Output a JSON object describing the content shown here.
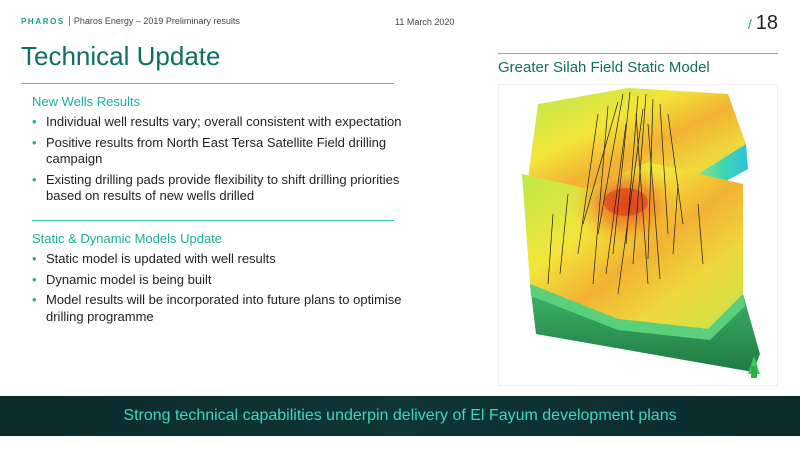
{
  "header": {
    "logo": "PHAROS",
    "subtitle": "Pharos Energy – 2019 Preliminary results",
    "date": "11 March 2020",
    "page_number": "18"
  },
  "title": "Technical Update",
  "image_title": "Greater Silah Field Static Model",
  "sections": [
    {
      "heading": "New Wells Results",
      "bullets": [
        "Individual well results vary; overall consistent with expectation",
        "Positive results from North East Tersa Satellite Field drilling campaign",
        "Existing drilling pads provide flexibility to shift drilling priorities based on results of new wells drilled"
      ]
    },
    {
      "heading": "Static & Dynamic Models Update",
      "bullets": [
        "Static model is updated with well results",
        "Dynamic model is being built",
        "Model results will be incorporated into future plans to optimise drilling programme"
      ]
    }
  ],
  "footer": "Strong technical capabilities underpin delivery of El Fayum development plans",
  "colors": {
    "brand_teal": "#0e6f66",
    "accent": "#1aae9c",
    "footer_bg": "#0f3535"
  }
}
